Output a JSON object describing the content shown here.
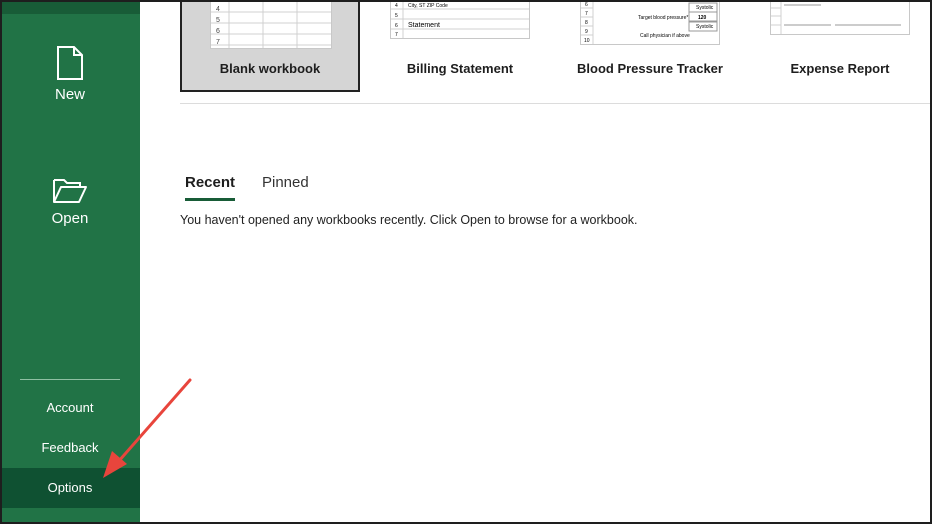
{
  "sidebar": {
    "new_label": "New",
    "open_label": "Open",
    "account_label": "Account",
    "feedback_label": "Feedback",
    "options_label": "Options"
  },
  "templates": [
    {
      "name": "Blank workbook",
      "rows": [
        "4",
        "5",
        "6",
        "7"
      ]
    },
    {
      "name": "Billing Statement",
      "rows": [
        "4",
        "5",
        "6",
        "7"
      ],
      "lines": [
        "City, ST ZIP Code",
        "Statement"
      ]
    },
    {
      "name": "Blood Pressure Tracker",
      "rows": [
        "6",
        "7",
        "8",
        "9",
        "10"
      ],
      "lines": [
        "Systolic",
        "Target blood pressure*",
        "120",
        "Systolic",
        "Call physician if above"
      ]
    },
    {
      "name": "Expense Report"
    }
  ],
  "tabs": {
    "recent": "Recent",
    "pinned": "Pinned"
  },
  "recent_message": "You haven't opened any workbooks recently. Click Open to browse for a workbook.",
  "colors": {
    "sidebar": "#217346",
    "sidebar_selected": "#0f5132",
    "arrow": "#e8453c"
  }
}
